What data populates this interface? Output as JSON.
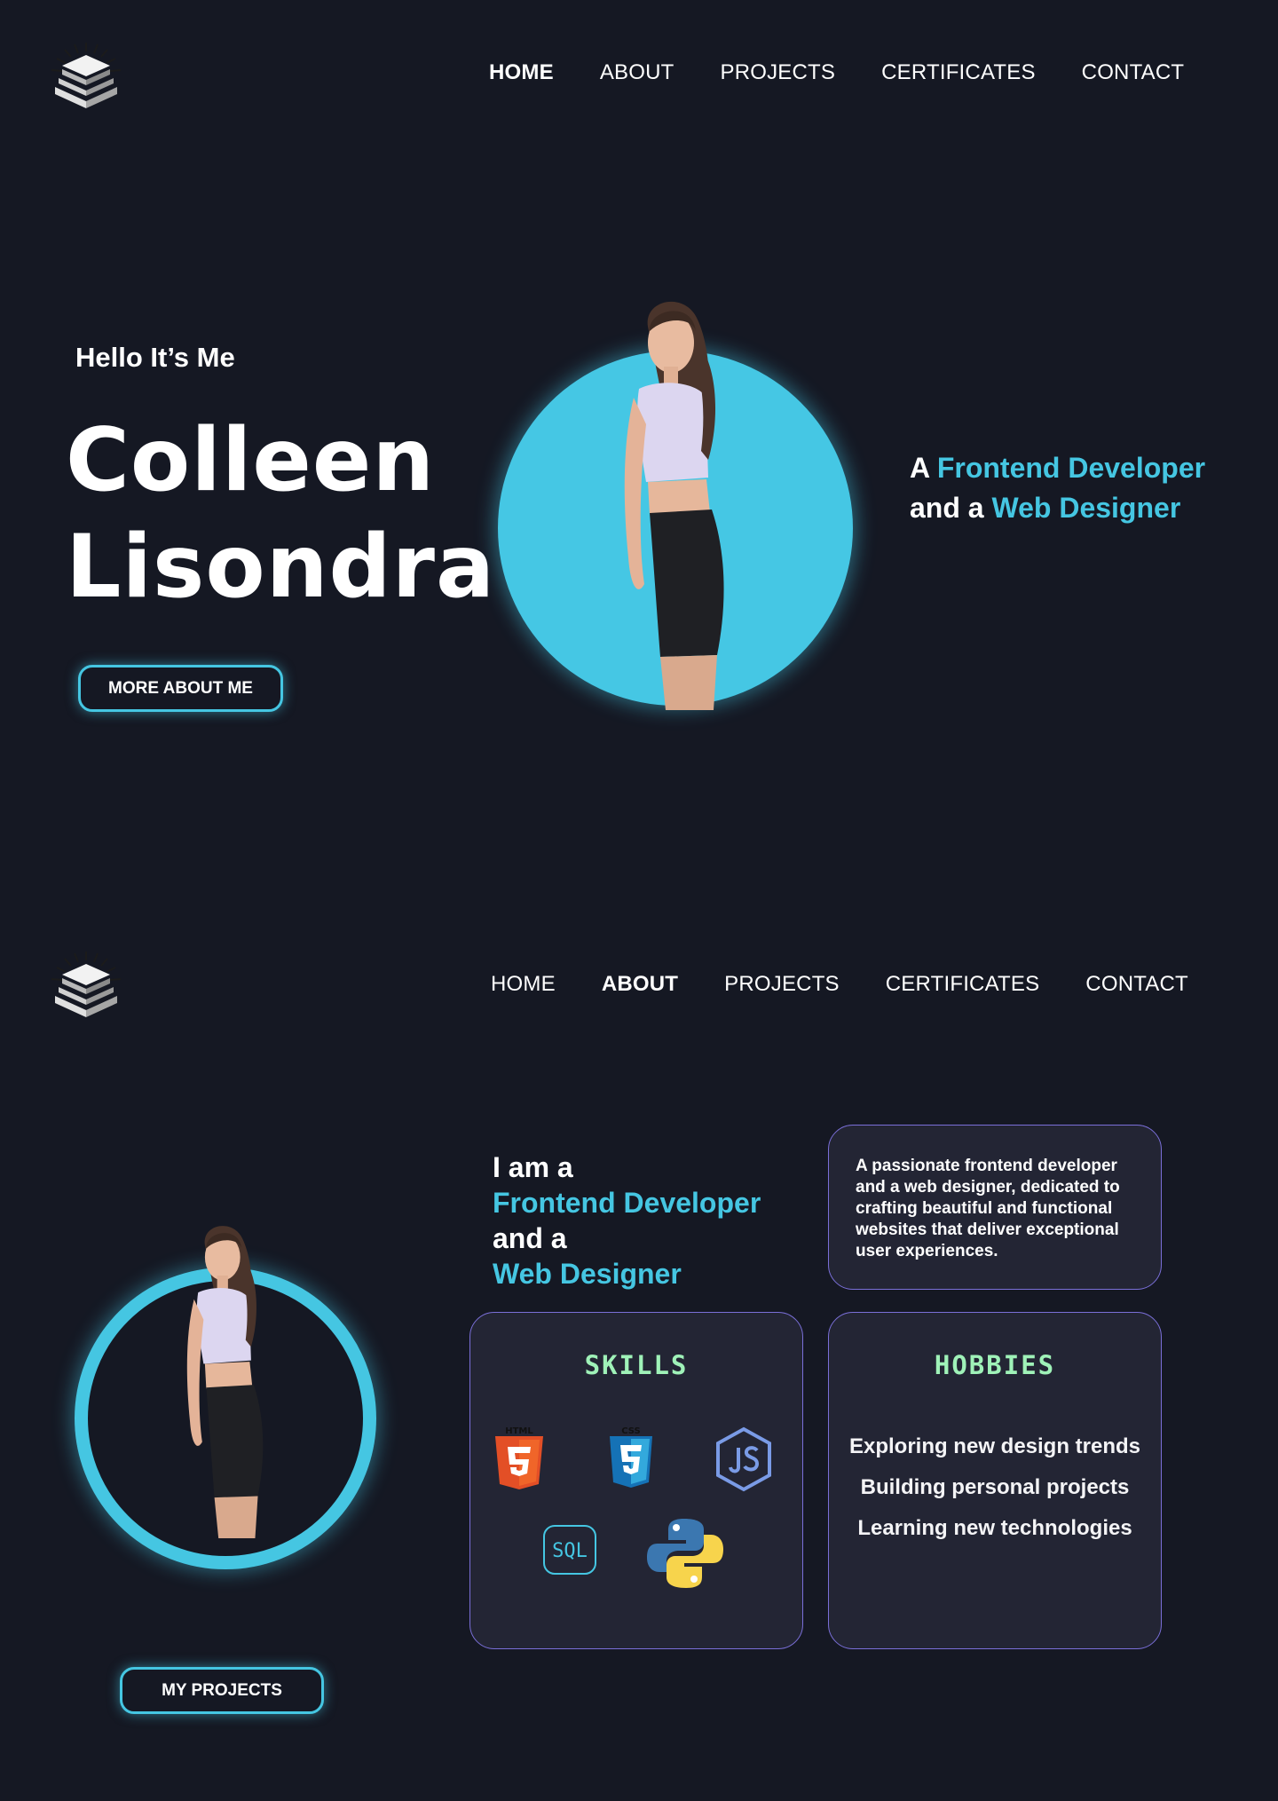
{
  "nav": {
    "items": [
      "HOME",
      "ABOUT",
      "PROJECTS",
      "CERTIFICATES",
      "CONTACT"
    ]
  },
  "hero": {
    "greeting": "Hello It’s Me",
    "first_name": "Colleen",
    "last_name": "Lisondra",
    "button_label": "MORE ABOUT ME",
    "tagline": {
      "a": "A",
      "role1": "Frontend Developer",
      "and": "and a",
      "role2": "Web Designer"
    }
  },
  "about": {
    "intro": {
      "iama": "I am a",
      "role1": "Frontend Developer",
      "and": "and a",
      "role2": "Web Designer"
    },
    "description": "A passionate frontend developer and a web designer, dedicated to crafting beautiful and functional websites that deliver exceptional user experiences.",
    "skills": {
      "title": "SKILLS",
      "icons": [
        "html5-icon",
        "css3-icon",
        "nodejs-icon",
        "sql-icon",
        "python-icon"
      ],
      "html_label": "HTML",
      "css_label": "CSS",
      "sql_label": "SQL"
    },
    "hobbies": {
      "title": "HOBBIES",
      "items": [
        "Exploring new design trends",
        "Building personal projects",
        "Learning new technologies"
      ]
    },
    "button_label": "MY PROJECTS"
  },
  "colors": {
    "background": "#151823",
    "accent": "#45c6e2",
    "card": "#232534",
    "card_title": "#9ff2b8"
  }
}
